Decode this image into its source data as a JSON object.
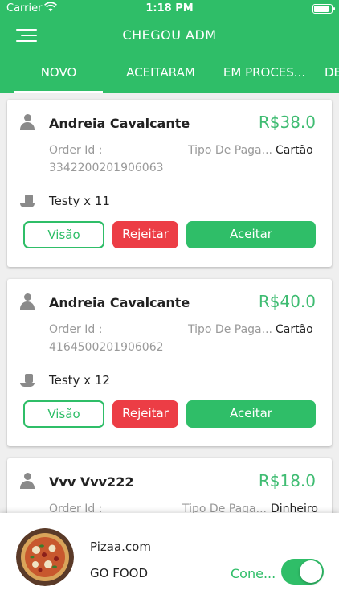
{
  "status_bar": {
    "carrier": "Carrier",
    "time": "1:18 PM"
  },
  "header": {
    "title": "CHEGOU ADM",
    "menu_icon": "hamburger-menu-icon"
  },
  "tabs": [
    {
      "label": "NOVO",
      "active": true
    },
    {
      "label": "ACEITARAM",
      "active": false
    },
    {
      "label": "EM PROCES...",
      "active": false
    },
    {
      "label": "DE",
      "active": false
    }
  ],
  "orders": [
    {
      "customer": "Andreia Cavalcante",
      "price": "R$38.0",
      "order_id_label": "Order Id :",
      "order_id": "3342200201906063",
      "payment_label": "Tipo De Paga...",
      "payment_value": "Cartão",
      "item": "Testy x 11",
      "view_label": "Visão",
      "reject_label": "Rejeitar",
      "accept_label": "Aceitar"
    },
    {
      "customer": "Andreia Cavalcante",
      "price": "R$40.0",
      "order_id_label": "Order Id :",
      "order_id": "4164500201906062",
      "payment_label": "Tipo De Paga...",
      "payment_value": "Cartão",
      "item": "Testy x 12",
      "view_label": "Visão",
      "reject_label": "Rejeitar",
      "accept_label": "Aceitar"
    },
    {
      "customer": "Vvv Vvv222",
      "price": "R$18.0",
      "order_id_label": "Order Id :",
      "payment_label": "Tipo De Paga...",
      "payment_value": "Dinheiro"
    }
  ],
  "store": {
    "name": "Pizaa.com",
    "type": "GO FOOD",
    "connection_label": "Cone...",
    "connected": true
  },
  "colors": {
    "primary": "#2fbe68",
    "price": "#3fbc72",
    "reject": "#ec3d45"
  }
}
